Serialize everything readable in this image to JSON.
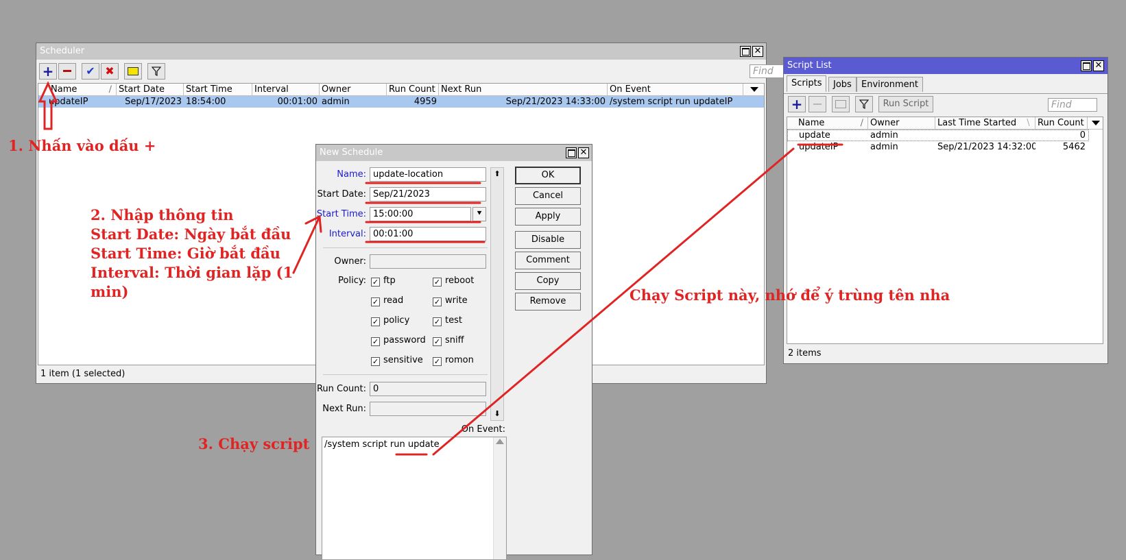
{
  "scheduler": {
    "title": "Scheduler",
    "find_placeholder": "Find",
    "columns": [
      "Name",
      "Start Date",
      "Start Time",
      "Interval",
      "Owner",
      "Run Count",
      "Next Run",
      "On Event"
    ],
    "rows": [
      {
        "name": "updateIP",
        "start_date": "Sep/17/2023",
        "start_time": "18:54:00",
        "interval": "00:01:00",
        "owner": "admin",
        "run_count": "4959",
        "next_run": "Sep/21/2023 14:33:00",
        "on_event": "/system script run updateIP"
      }
    ],
    "status": "1 item (1 selected)"
  },
  "new_schedule": {
    "title": "New Schedule",
    "labels": {
      "name": "Name:",
      "start_date": "Start Date:",
      "start_time": "Start Time:",
      "interval": "Interval:",
      "owner": "Owner:",
      "policy": "Policy:",
      "run_count": "Run Count:",
      "next_run": "Next Run:",
      "on_event": "On Event:"
    },
    "values": {
      "name": "update-location",
      "start_date": "Sep/21/2023",
      "start_time": "15:00:00",
      "interval": "00:01:00",
      "owner": "",
      "run_count": "0",
      "next_run": "",
      "on_event": "/system script run update"
    },
    "policies": [
      "ftp",
      "reboot",
      "read",
      "write",
      "policy",
      "test",
      "password",
      "sniff",
      "sensitive",
      "romon"
    ],
    "buttons": [
      "OK",
      "Cancel",
      "Apply",
      "Disable",
      "Comment",
      "Copy",
      "Remove"
    ]
  },
  "script_list": {
    "title": "Script List",
    "tabs": [
      "Scripts",
      "Jobs",
      "Environment"
    ],
    "run_script_label": "Run Script",
    "find_placeholder": "Find",
    "columns": [
      "Name",
      "Owner",
      "Last Time Started",
      "Run Count"
    ],
    "rows": [
      {
        "name": "update",
        "owner": "admin",
        "last_started": "",
        "run_count": "0"
      },
      {
        "name": "updateIP",
        "owner": "admin",
        "last_started": "Sep/21/2023 14:32:00",
        "run_count": "5462"
      }
    ],
    "status": "2 items"
  },
  "annotations": {
    "step1": "1. Nhấn vào dấu +",
    "step2_lines": [
      "2. Nhập thông tin",
      "Start Date: Ngày bắt đầu",
      "Start Time: Giờ bắt đầu",
      "Interval: Thời gian lặp (1",
      "min)"
    ],
    "step3": "3. Chạy script",
    "note": "Chạy Script này, nhớ để ý trùng tên nha"
  },
  "colors": {
    "annotation": "#e02424",
    "selection": "#a9c8f0",
    "active_title": "#5a5ad2",
    "inactive_title": "#c8c8c8",
    "desktop": "#a0a0a0"
  },
  "icons": [
    "add-icon",
    "remove-icon",
    "enable-icon",
    "disable-icon",
    "comment-icon",
    "filter-icon",
    "maximize-icon",
    "close-icon",
    "dropdown-icon",
    "scroll-up-icon",
    "scroll-down-icon"
  ]
}
